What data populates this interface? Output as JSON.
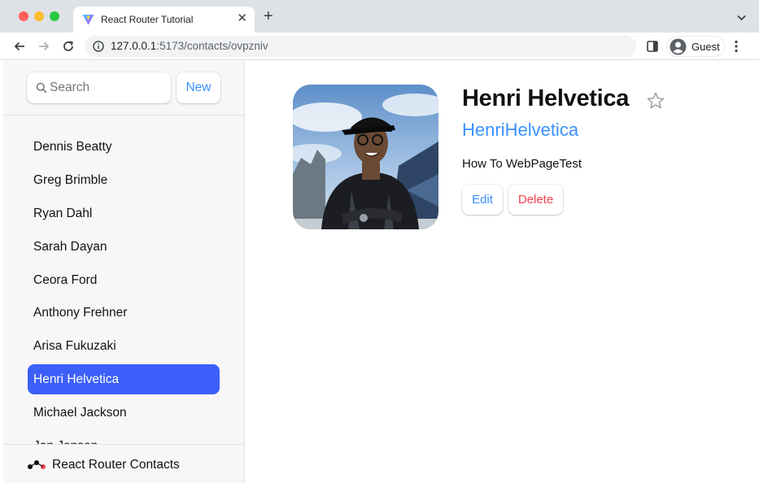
{
  "browser": {
    "tab_title": "React Router Tutorial",
    "tab_close": "✕",
    "new_tab": "+",
    "url_host": "127.0.0.1",
    "url_path": ":5173/contacts/ovpzniv",
    "profile_name": "Guest"
  },
  "sidebar": {
    "search_placeholder": "Search",
    "new_button": "New",
    "contacts": [
      "Dennis Beatty",
      "Greg Brimble",
      "Ryan Dahl",
      "Sarah Dayan",
      "Ceora Ford",
      "Anthony Frehner",
      "Arisa Fukuzaki",
      "Henri Helvetica",
      "Michael Jackson",
      "Jon Jensen"
    ],
    "active_contact": "Henri Helvetica",
    "footer_title": "React Router Contacts"
  },
  "contact": {
    "name": "Henri Helvetica",
    "handle": "HenriHelvetica",
    "notes": "How To WebPageTest",
    "favorite": false,
    "edit_label": "Edit",
    "delete_label": "Delete"
  },
  "colors": {
    "accent": "#3992ff",
    "active_bg": "#3c5ffa",
    "danger": "#f44250",
    "sidebar_bg": "#f7f7f7"
  }
}
